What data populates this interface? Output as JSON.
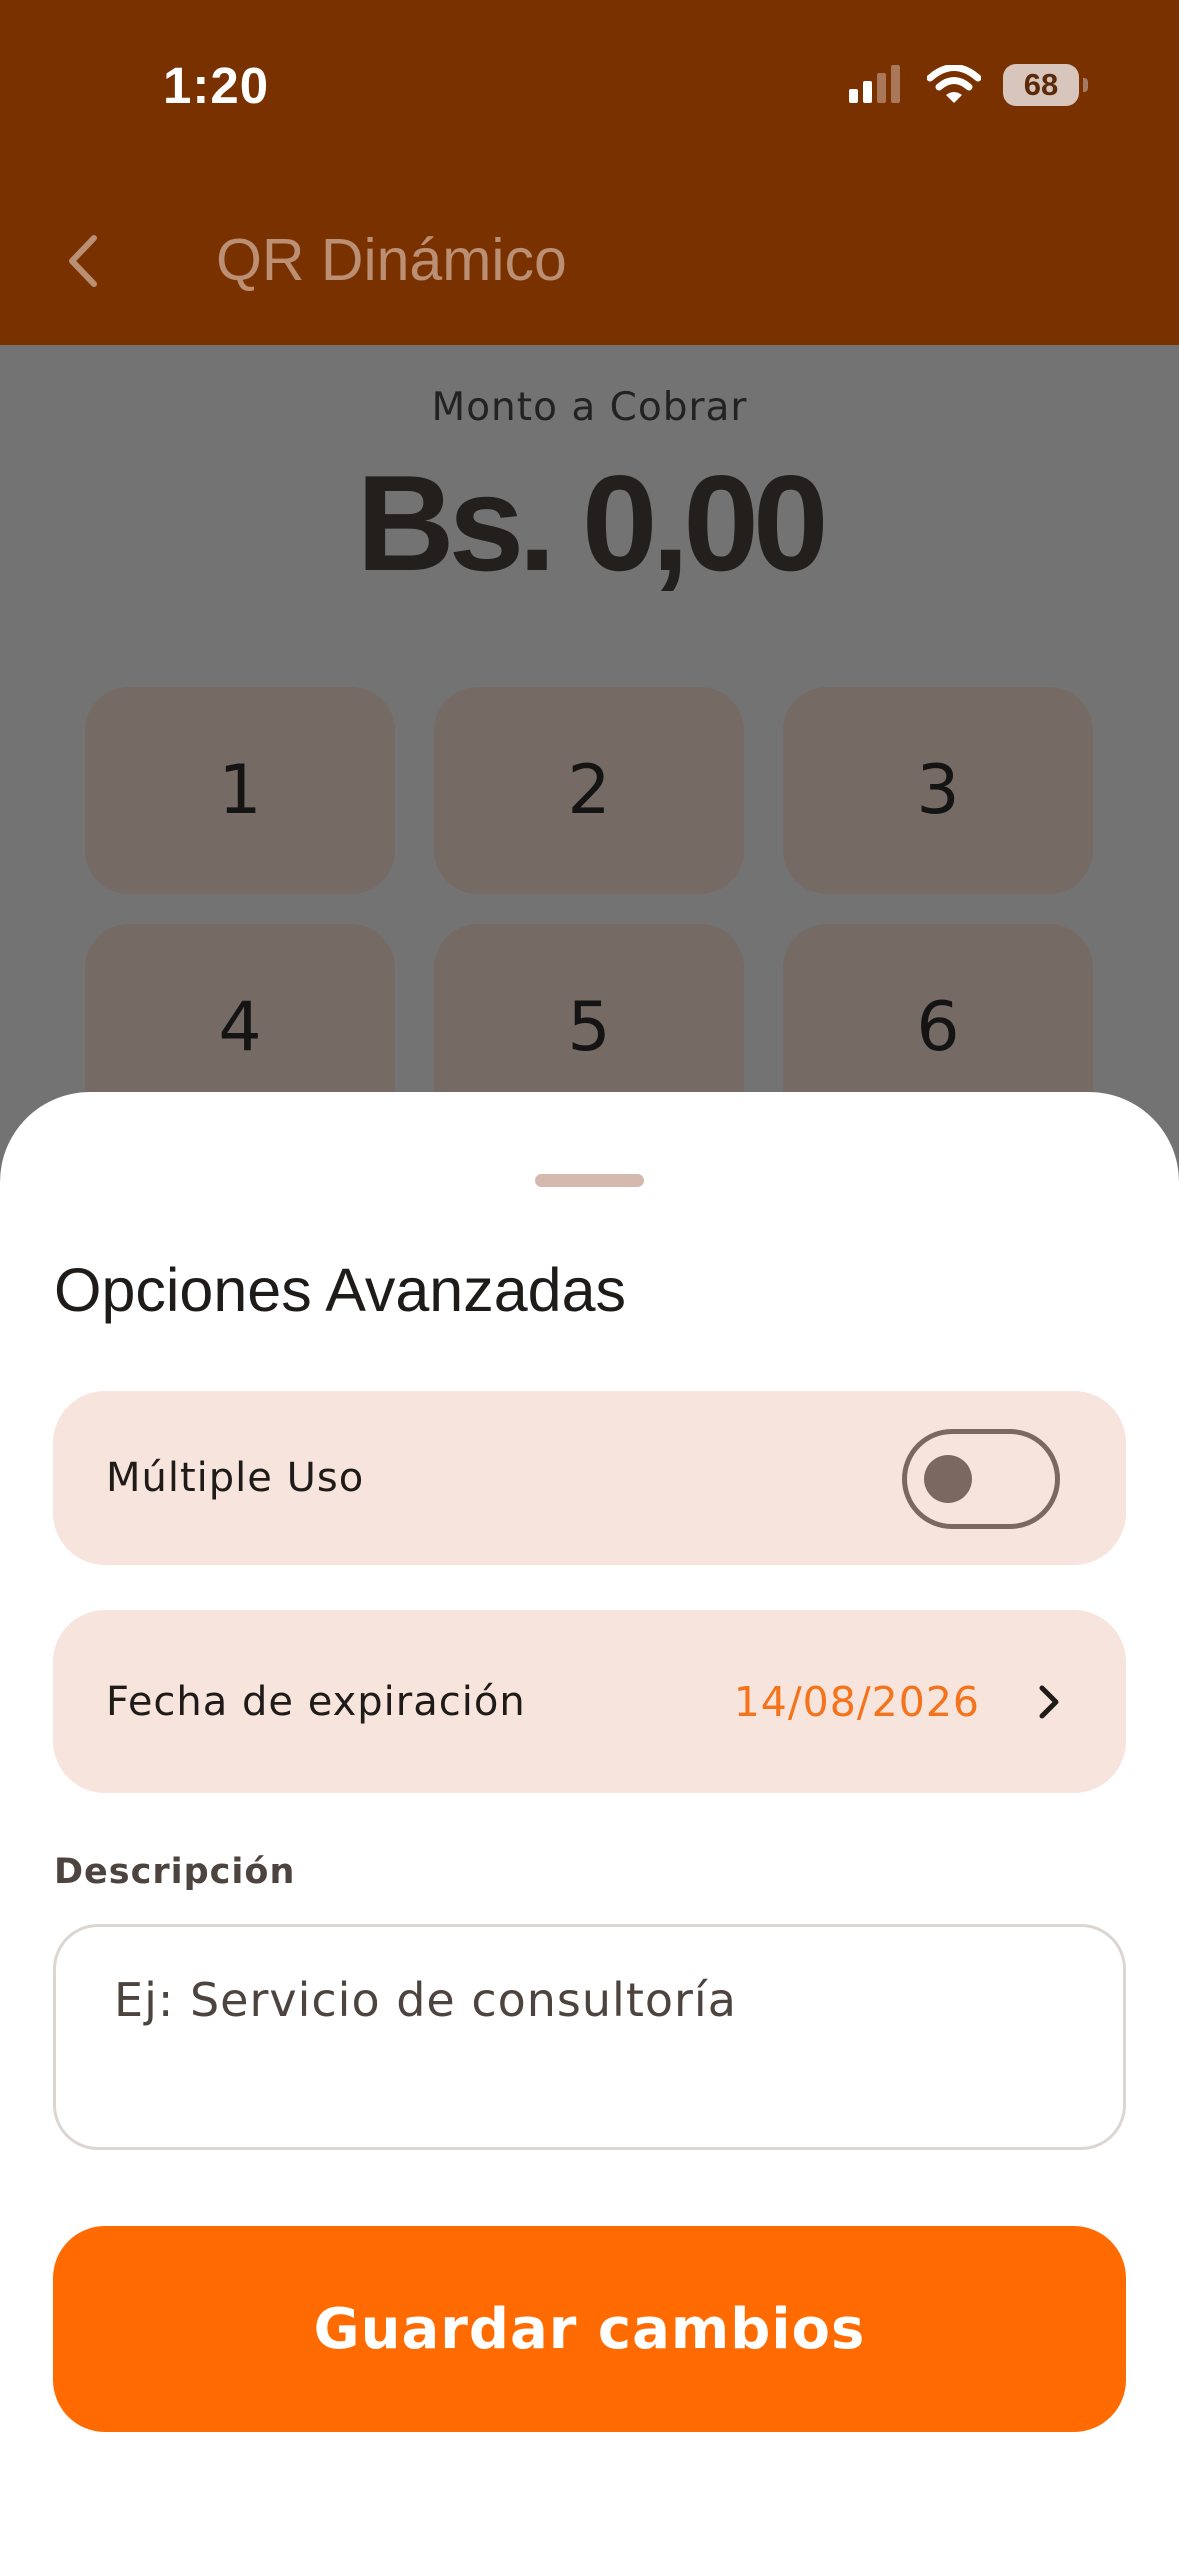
{
  "status_bar": {
    "time": "1:20",
    "battery": "68",
    "icons": [
      "cellular-signal-icon",
      "wifi-icon",
      "battery-icon"
    ]
  },
  "nav": {
    "back_icon": "chevron-left-icon",
    "title": "QR Dinámico"
  },
  "amount": {
    "label": "Monto a Cobrar",
    "value": "Bs. 0,00"
  },
  "keypad": {
    "keys": [
      "1",
      "2",
      "3",
      "4",
      "5",
      "6"
    ]
  },
  "sheet": {
    "title": "Opciones Avanzadas",
    "multiple_use": {
      "label": "Múltiple Uso",
      "enabled": false
    },
    "expiration": {
      "label": "Fecha de expiración",
      "value": "14/08/2026",
      "chevron_icon": "chevron-right-icon"
    },
    "description": {
      "label": "Descripción",
      "value": "",
      "placeholder": "Ej: Servicio de consultoría"
    },
    "save_label": "Guardar cambios"
  },
  "colors": {
    "header": "#7a3100",
    "accent": "#ff6b00",
    "date_text": "#f5731a",
    "row_background": "#f6e4dd",
    "dim_overlay": "#737373"
  }
}
